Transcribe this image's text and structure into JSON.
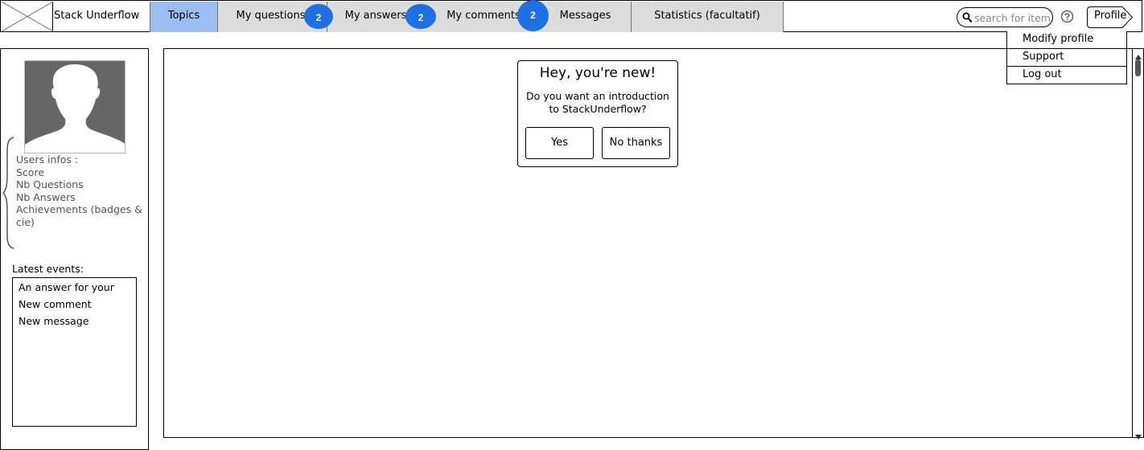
{
  "app": {
    "title": "Stack Underflow"
  },
  "tabs": [
    {
      "label": "Topics",
      "active": true
    },
    {
      "label": "My questions",
      "badge": "2"
    },
    {
      "label": "My answers",
      "badge": "2"
    },
    {
      "label": "My comments",
      "badge": "2"
    },
    {
      "label": "Messages"
    },
    {
      "label": "Statistics (facultatif)"
    }
  ],
  "search": {
    "placeholder": "search for item",
    "icon": "magnifier"
  },
  "help": {
    "icon": "question-circle"
  },
  "profile": {
    "label": "Profile",
    "menu": [
      "Modify profile",
      "Support",
      "Log out"
    ]
  },
  "sidebar": {
    "user_info": [
      "Users infos :",
      "Score",
      "Nb Questions",
      "Nb Answers",
      "Achievements (badges & cie)"
    ],
    "latest_events_title": "Latest events:",
    "events": [
      "An answer for your",
      "New comment",
      "New message"
    ]
  },
  "dialog": {
    "title": "Hey, you're new!",
    "text": "Do you want an introduction to StackUnderflow?",
    "yes_label": "Yes",
    "no_label": "No thanks"
  },
  "colors": {
    "active_tab": "#9bbdf2",
    "inactive_tab": "#dcdcdc",
    "badge": "#1f70e3",
    "avatar": "#666666"
  }
}
